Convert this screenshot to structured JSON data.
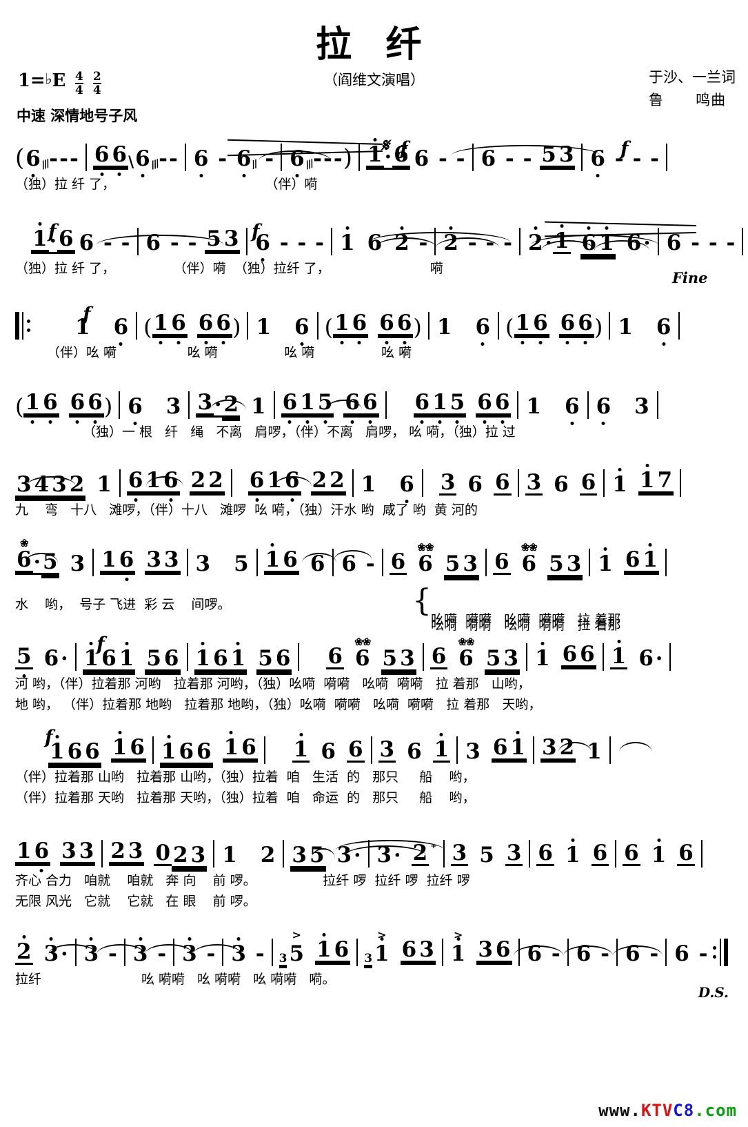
{
  "header": {
    "title": "拉            纤",
    "performer": "（阎维文演唱）",
    "key_label": "1=",
    "key_accidental": "♭",
    "key_note": "E",
    "time_sig_1_num": "4",
    "time_sig_1_den": "4",
    "time_sig_2_num": "2",
    "time_sig_2_den": "4",
    "tempo": "中速 深情地号子风",
    "lyricist": "于沙、一兰词",
    "composer_a": "鲁",
    "composer_b": "鸣曲"
  },
  "marks": {
    "segno": "𝄋",
    "forte": "f",
    "fine": "Fine",
    "ds": "D.S."
  },
  "systems": [
    {
      "id": "system-1",
      "notes_text": "( 6̣ - - - | 6̣ 6̣ 6̣ - - | 6̣ - 6̣ - | 6̣ - - - ) | 1̇·6 6 - - | 6 - - 5 3 | 6̣ - - -",
      "lyrics_1": "（独）拉 纤 了，                                    （伴）嗬",
      "lyrics_2": ""
    },
    {
      "id": "system-2",
      "notes_text": "1̇·6 6 - - | 6 - - 5 3 | 6̣ - - - | 1̇ 6 2̇ - | 2̇ - - - | 2̇· 1̇ 6̇1̇ 6· | 6 - - - | 6 - - -",
      "lyrics_1": "（独）拉 纤 了，              （伴）嗬  （独）拉纤 了，                        嗬",
      "lyrics_2": ""
    },
    {
      "id": "system-3",
      "notes_text": "‖: 1 6̣ | ( 1 6̣ 6̣ 6̣ ) | 1 6̣ | ( 1 6̣ 6̣ 6̣ ) | 1 6̣ | ( 1 6̣ 6̣ 6̣ ) | 1 6̣ |",
      "lyrics_1": "（伴）吆 嗬                 吆 嗬                吆 嗬                吆 嗬",
      "lyrics_2": ""
    },
    {
      "id": "system-4",
      "notes_text": "( 1 6̣ 6̣ 6̣ ) | 6̣ 3 | 3·2 1 | 6̣ 1̣ 5̣ 6̣ 6̣ | 6̣ 1̣ 5̣ 6̣ 6̣ | 1 6̣ | 6̣ 3 |",
      "lyrics_1": "（独）一 根   纤   绳   不离   肩啰，（伴）不离   肩啰， 吆 嗬，（独）拉 过",
      "lyrics_2": ""
    },
    {
      "id": "system-5",
      "notes_text": "3432 1 | 6̣ 1 6̣ 2 2 | 6̣ 1 6̣ 2 2 | 1 6̣ | 3 6 6 | 3 6 6 | 1̇ 1̇ 7 |",
      "lyrics_1": "九    弯   十八   滩啰，（伴）十八   滩啰  吆 嗬，（独）汗水 哟  咸了 哟  黄 河的",
      "lyrics_2": ""
    },
    {
      "id": "system-6",
      "notes_text": "6·5 3 | 1 6̣ 3 3 | 3 5 | 1̇ 6 6 | 6 - | 6̣ 6̇ 5 3 | 6̣ 6̇ 5 3 | 1̇ 6 1̇ |",
      "lyrics_1": "水    哟，  号子 飞进  彩 云    间啰。",
      "lyrics_2_a": "吆嗬  嗬嗬   吆嗬  嗬嗬   拉 着那",
      "lyrics_2_b": "吆嗬  嗬嗬   吆嗬  嗬嗬   拉 着那"
    },
    {
      "id": "system-7",
      "notes_text": "5̣ 6· | 1̇ 6 1̇ 5 6 | 1̇ 6 1̇ 5 6 | 6̣ 6̇ 5 3 | 6̣ 6̇ 5 3 | 1̇ 6 6 | 1̇ 6· |",
      "lyrics_1": "河 哟，（伴）拉着那 河哟   拉着那 河哟，（独）吆嗬  嗬嗬   吆嗬  嗬嗬   拉 着那   山哟，",
      "lyrics_2": "地 哟， （伴）拉着那 地哟   拉着那 地哟，（独）吆嗬  嗬嗬   吆嗬  嗬嗬   拉 着那   天哟，"
    },
    {
      "id": "system-8",
      "notes_text": "1̇ 6 6 1̇ 6 | 1̇ 6 6 1̇ 6 | 1̇ 6 6 | 3 6 1̇ | 3 6 1̇ | 3 2 1 |",
      "lyrics_1": "（伴）拉着那 山哟   拉着那 山哟，（独）拉着  咱   生活  的   那只     船    哟，",
      "lyrics_2": "（伴）拉着那 天哟   拉着那 天哟，（独）拉着  咱   命运  的   那只     船    哟，"
    },
    {
      "id": "system-9",
      "notes_text": "1 6̣ 3 3 | 2 3 0 2 3 | 1 2 | 35 3· | 3· 2 | 3 5 3 | 6 1̇ 6 | 6 1̇ 6 |",
      "lyrics_1": "齐心 合力   咱就    咱就   奔 向    前 啰。                拉纤 啰  拉纤 啰  拉纤 啰",
      "lyrics_2": "无限 风光   它就    它就   在 眼    前 啰。"
    },
    {
      "id": "system-10",
      "notes_text": "2̇ 3· | 3 - | 3 - | 3 - | 3 - | 3̇5 1 6 | 3̇1̇ 6 3 | 1̇ 3 6 | 6 - | 6 - | 6 - | 6 - :‖",
      "lyrics_1": "拉纤                        吆 嗬嗬   吆 嗬嗬   吆 嗬嗬   嗬。",
      "lyrics_2": ""
    }
  ],
  "watermark": {
    "part_w": "www.",
    "part_ktv": "KTV",
    "part_c8": "C8",
    "part_com": ".com"
  }
}
